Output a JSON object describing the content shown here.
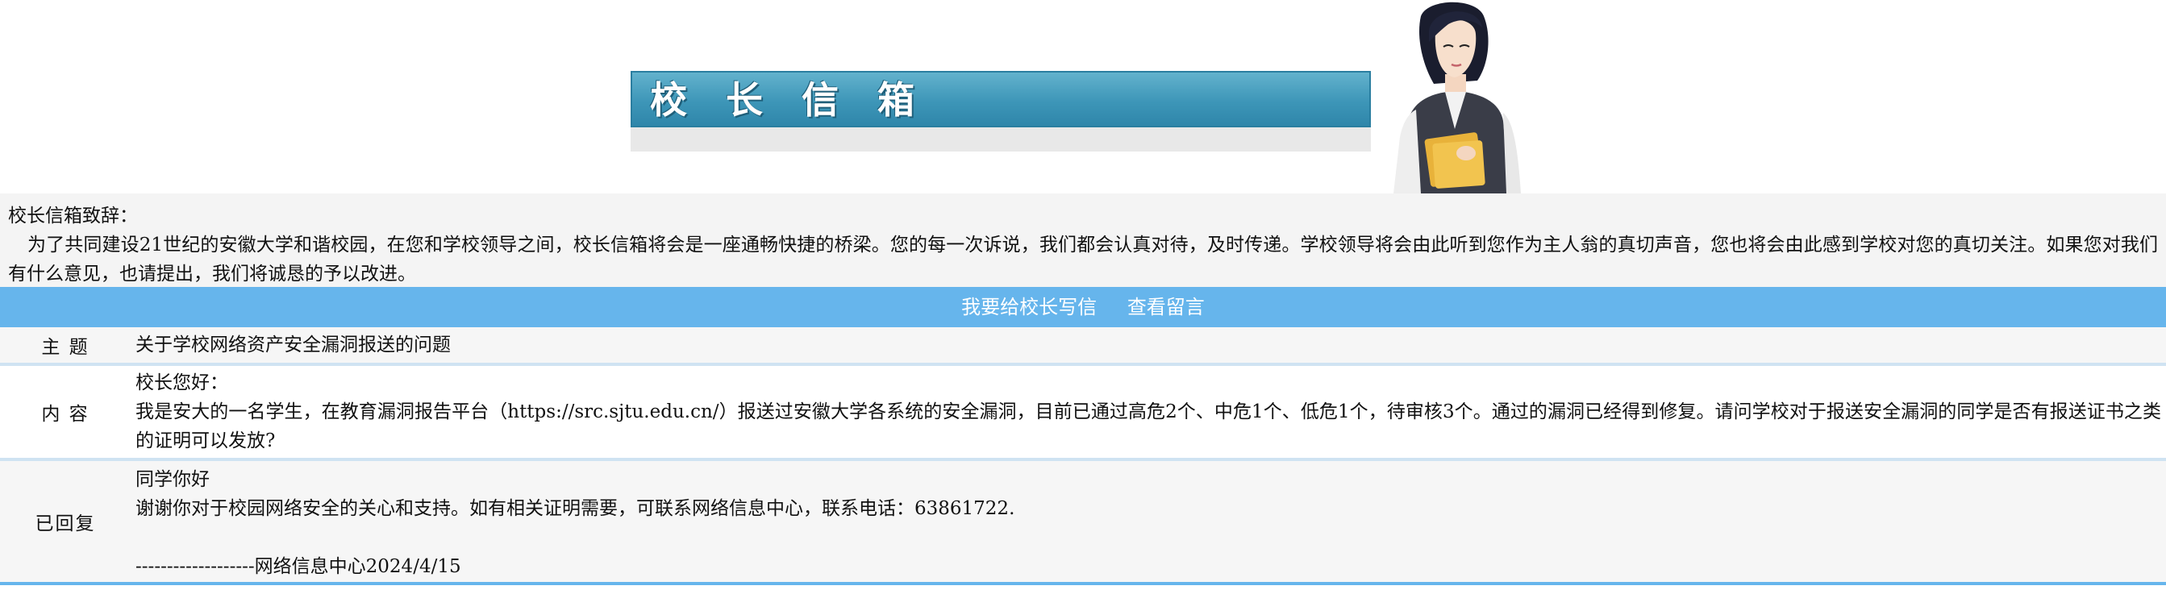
{
  "banner": {
    "title": "校 长 信 箱",
    "colors": {
      "bar": "#3d96b8",
      "strip": "#e8e8e8"
    }
  },
  "intro": {
    "heading": "校长信箱致辞：",
    "body": "为了共同建设21世纪的安徽大学和谐校园，在您和学校领导之间，校长信箱将会是一座通畅快捷的桥梁。您的每一次诉说，我们都会认真对待，及时传递。学校领导将会由此听到您作为主人翁的真切声音，您也将会由此感到学校对您的真切关注。如果您对我们有什么意见，也请提出，我们将诚恳的予以改进。"
  },
  "nav": {
    "write_letter": "我要给校长写信",
    "view_messages": "查看留言",
    "color": "#66b5ec"
  },
  "message": {
    "subject_label": "主 题",
    "subject": "关于学校网络资产安全漏洞报送的问题",
    "content_label": "内 容",
    "greeting": "校长您好：",
    "content": "我是安大的一名学生，在教育漏洞报告平台（https://src.sjtu.edu.cn/）报送过安徽大学各系统的安全漏洞，目前已通过高危2个、中危1个、低危1个，待审核3个。通过的漏洞已经得到修复。请问学校对于报送安全漏洞的同学是否有报送证书之类的证明可以发放?",
    "reply_label": "已回复",
    "reply_greeting": "同学你好",
    "reply_body": "谢谢你对于校园网络安全的关心和支持。如有相关证明需要，可联系网络信息中心，联系电话：63861722.",
    "reply_signature": "-------------------网络信息中心2024/4/15"
  }
}
